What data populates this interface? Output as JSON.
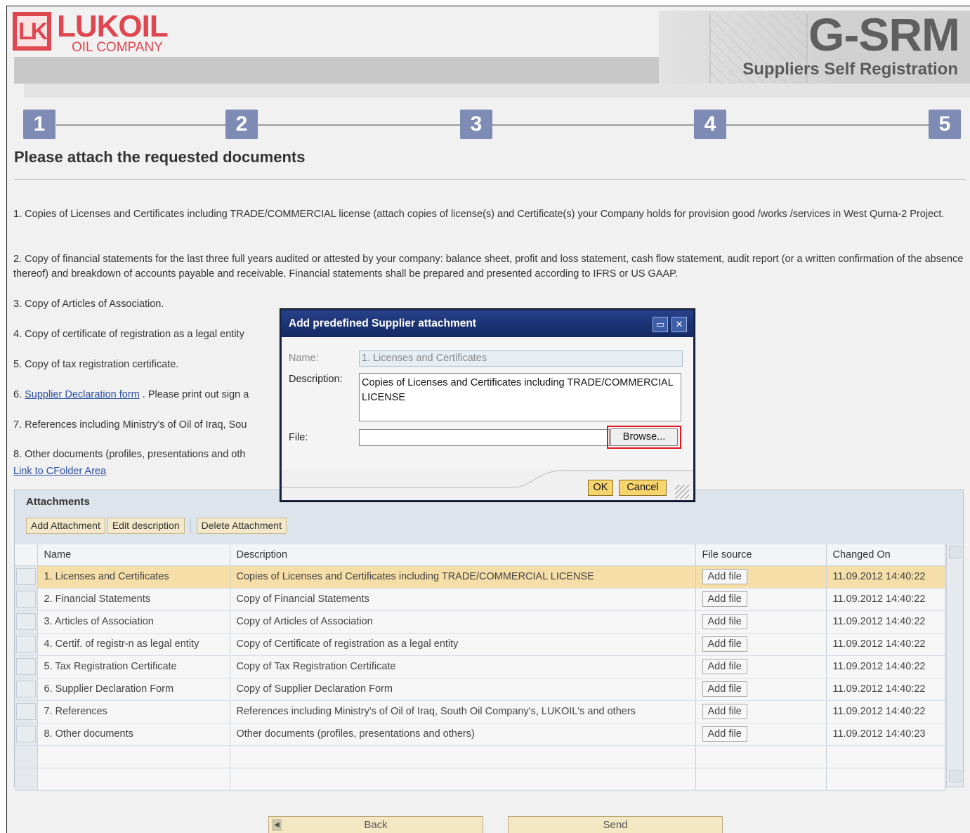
{
  "header": {
    "logo_mark": "LK",
    "logo_name": "LUKOIL",
    "logo_sub": "OIL COMPANY",
    "app_title": "G-SRM",
    "app_subtitle": "Suppliers Self Registration"
  },
  "steps": [
    "1",
    "2",
    "3",
    "4",
    "5"
  ],
  "page_title": "Please attach the requested documents",
  "instructions": [
    {
      "text": "1. Copies of Licenses and Certificates including TRADE/COMMERCIAL license (attach copies of license(s) and Certificate(s) your Company holds for provision good /works /services in West Qurna-2 Project."
    },
    {
      "text": "2. Copy of financial statements for the last three full years audited or attested by your company: balance sheet, profit and loss statement, cash flow statement, audit report (or a written confirmation of the absence thereof) and breakdown of accounts payable and receivable. Financial statements shall be prepared and presented according to IFRS or US GAAP."
    },
    {
      "text": "3. Copy of Articles of Association."
    },
    {
      "text": "4. Copy of certificate of registration as a legal entity"
    },
    {
      "text": "5. Copy of tax registration certificate."
    },
    {
      "prefix": "6. ",
      "link": "Supplier Declaration form",
      "suffix": " . Please print out sign a"
    },
    {
      "text": "7. References including Ministry's of Oil of Iraq, Sou"
    },
    {
      "text": "8. Other documents (profiles, presentations and oth"
    }
  ],
  "cfolder_link": "Link to CFolder Area",
  "attachments": {
    "title": "Attachments",
    "toolbar": {
      "add": "Add Attachment",
      "edit": "Edit description",
      "delete": "Delete Attachment"
    },
    "columns": [
      "Name",
      "Description",
      "File source",
      "Changed On"
    ],
    "rows": [
      {
        "name": "1. Licenses and Certificates",
        "description": "Copies of Licenses and Certificates including TRADE/COMMERCIAL LICENSE",
        "file_source": "Add file",
        "changed_on": "11.09.2012 14:40:22"
      },
      {
        "name": "2. Financial Statements",
        "description": "Copy of Financial Statements",
        "file_source": "Add file",
        "changed_on": "11.09.2012 14:40:22"
      },
      {
        "name": "3. Articles of Association",
        "description": "Copy of Articles of Association",
        "file_source": "Add file",
        "changed_on": "11.09.2012 14:40:22"
      },
      {
        "name": "4. Certif. of registr-n as legal entity",
        "description": "Copy of Certificate of registration as a legal entity",
        "file_source": "Add file",
        "changed_on": "11.09.2012 14:40:22"
      },
      {
        "name": "5. Tax Registration Certificate",
        "description": "Copy of Tax Registration Certificate",
        "file_source": "Add file",
        "changed_on": "11.09.2012 14:40:22"
      },
      {
        "name": "6. Supplier Declaration Form",
        "description": "Copy of Supplier Declaration Form",
        "file_source": "Add file",
        "changed_on": "11.09.2012 14:40:22"
      },
      {
        "name": "7. References",
        "description": "References including Ministry's of Oil of Iraq, South Oil Company's, LUKOIL's and others",
        "file_source": "Add file",
        "changed_on": "11.09.2012 14:40:22"
      },
      {
        "name": "8. Other documents",
        "description": "Other documents (profiles, presentations and others)",
        "file_source": "Add file",
        "changed_on": "11.09.2012 14:40:23"
      }
    ]
  },
  "nav": {
    "back": "Back",
    "send": "Send"
  },
  "dialog": {
    "title": "Add predefined Supplier attachment",
    "name_label": "Name:",
    "name_value": "1. Licenses and Certificates",
    "description_label": "Description:",
    "description_value": "Copies of Licenses and Certificates including TRADE/COMMERCIAL LICENSE",
    "file_label": "File:",
    "file_value": "",
    "browse": "Browse...",
    "ok": "OK",
    "cancel": "Cancel"
  },
  "colors": {
    "brand_red": "#e0464f",
    "step_blue": "#7d8bb5",
    "dialog_title_blue": "#1b3373",
    "selected_row": "#f5dea7",
    "button_gold": "#f7d46c",
    "highlight_red": "#e0151d"
  }
}
